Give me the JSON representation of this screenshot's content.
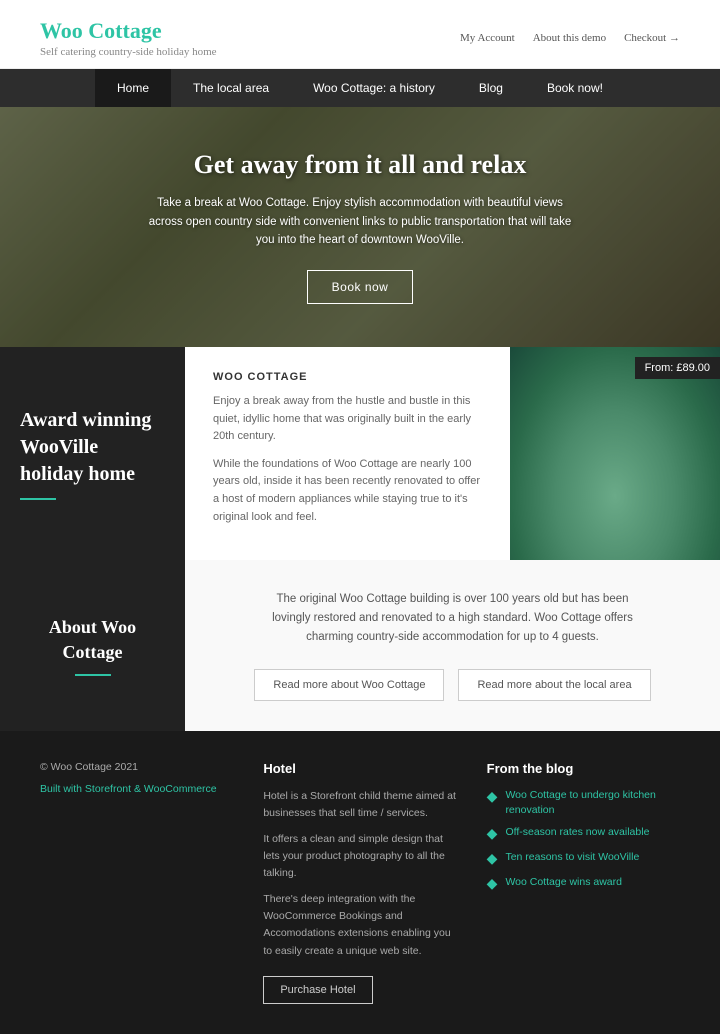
{
  "header": {
    "logo_title": "Woo Cottage",
    "logo_sub": "Self catering country-side holiday home",
    "link_my_account": "My Account",
    "link_about": "About this demo",
    "link_checkout": "Checkout"
  },
  "nav": {
    "items": [
      {
        "label": "Home",
        "active": true
      },
      {
        "label": "The local area",
        "active": false
      },
      {
        "label": "Woo Cottage: a history",
        "active": false
      },
      {
        "label": "Blog",
        "active": false
      },
      {
        "label": "Book now!",
        "active": false
      }
    ]
  },
  "hero": {
    "title": "Get away from it all and relax",
    "description": "Take a break at Woo Cottage. Enjoy stylish accommodation with beautiful views across open country side with convenient links to public transportation that will take you into the heart of downtown WooVille.",
    "button_label": "Book now"
  },
  "award": {
    "heading": "Award winning WooVille holiday home",
    "underline_color": "#2ec4a5"
  },
  "cottage_info": {
    "heading": "WOO COTTAGE",
    "para1": "Enjoy a break away from the hustle and bustle in this quiet, idyllic home that was originally built in the early 20th century.",
    "para2": "While the foundations of Woo Cottage are nearly 100 years old, inside it has been recently renovated to offer a host of modern appliances while staying true to it's original look and feel.",
    "price_badge": "From: £89.00"
  },
  "about": {
    "heading": "About Woo Cottage",
    "description": "The original Woo Cottage building is over 100 years old but has been lovingly restored and renovated to a high standard. Woo Cottage offers charming country-side accommodation for up to 4 guests.",
    "btn1_label": "Read more about Woo Cottage",
    "btn2_label": "Read more about the local area"
  },
  "footer": {
    "copyright": "© Woo Cottage 2021",
    "built_with_label": "Built with Storefront & WooCommerce",
    "hotel_heading": "Hotel",
    "hotel_para1": "Hotel is a Storefront child theme aimed at businesses that sell time / services.",
    "hotel_para2": "It offers a clean and simple design that lets your product photography to all the talking.",
    "hotel_para3": "There's deep integration with the WooCommerce Bookings and Accomodations extensions enabling you to easily create a unique web site.",
    "hotel_btn_label": "Purchase Hotel",
    "blog_heading": "From the blog",
    "blog_items": [
      {
        "label": "Woo Cottage to undergo kitchen renovation"
      },
      {
        "label": "Off-season rates now available"
      },
      {
        "label": "Ten reasons to visit WooVille"
      },
      {
        "label": "Woo Cottage wins award"
      }
    ]
  }
}
